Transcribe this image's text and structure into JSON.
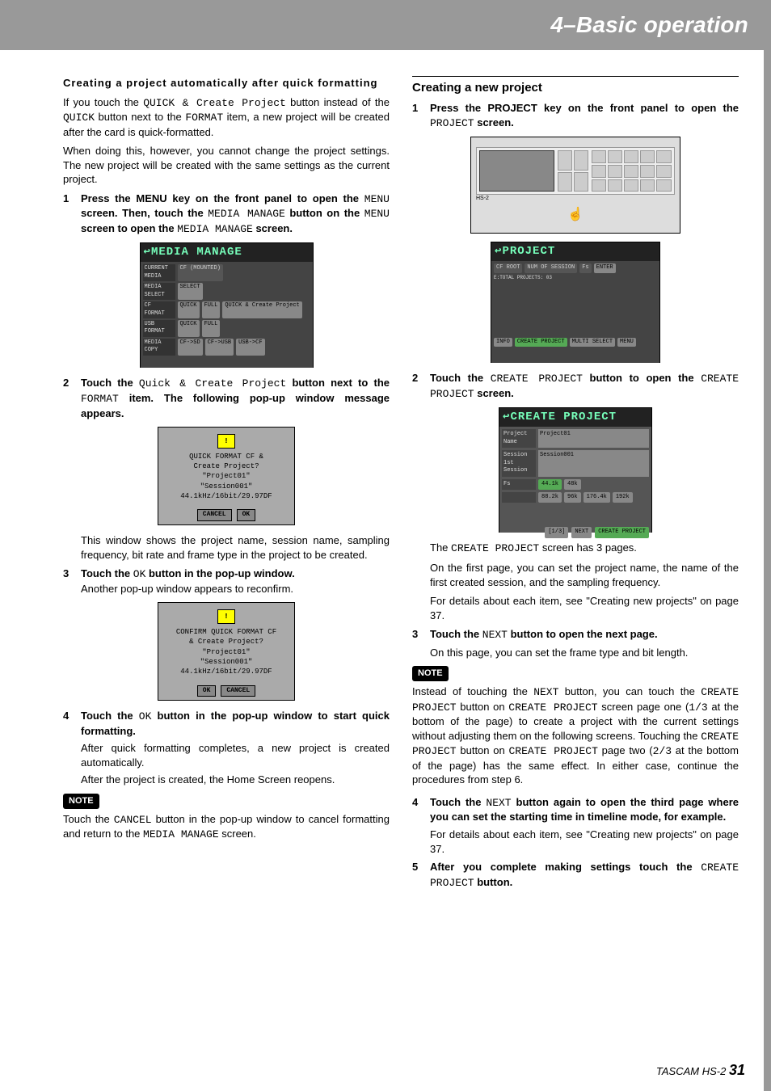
{
  "header": {
    "title": "4–Basic operation"
  },
  "left": {
    "sub_heading": "Creating a project automatically after quick formatting",
    "intro1_a": "If you touch the ",
    "intro1_mono_a": "QUICK & Create Project",
    "intro1_b": " button instead of the ",
    "intro1_mono_b": "QUICK",
    "intro1_c": " button next to the ",
    "intro1_mono_c": "FORMAT",
    "intro1_d": " item, a new project will be created after the card is quick-formatted.",
    "intro2": "When doing this, however, you cannot change the project settings. The new project will be created with the same settings as the current project.",
    "step1_a": "Press the MENU key on the front panel to open the ",
    "step1_mono_a": "MENU",
    "step1_b": " screen. Then, touch the ",
    "step1_mono_b": "MEDIA MANAGE",
    "step1_c": " button on the ",
    "step1_mono_c": "MENU",
    "step1_d": " screen to open the ",
    "step1_mono_d": "MEDIA MANAGE",
    "step1_e": " screen.",
    "step2_a": "Touch the ",
    "step2_mono_a": "Quick & Create Project",
    "step2_b": " button next to the ",
    "step2_mono_b": "FORMAT",
    "step2_c": " item. The following pop-up window message appears.",
    "after_popup1": "This window shows the project name, session name, sampling frequency, bit rate and frame type in the project to be created.",
    "step3_a": "Touch the ",
    "step3_mono_a": "OK",
    "step3_b": " button in the pop-up window.",
    "step3_after": "Another pop-up window appears to reconfirm.",
    "step4_a": "Touch the ",
    "step4_mono_a": "OK",
    "step4_b": " button in the pop-up window to start quick formatting.",
    "step4_after1": "After quick formatting completes, a new project is created automatically.",
    "step4_after2": "After the project is created, the Home Screen reopens.",
    "note_label": "NOTE",
    "note_a": "Touch the ",
    "note_mono_a": "CANCEL",
    "note_b": " button in the pop-up window to cancel formatting and return to the ",
    "note_mono_b": "MEDIA MANAGE",
    "note_c": " screen.",
    "media_shot": {
      "title": "MEDIA MANAGE",
      "rows": [
        {
          "label": "CURRENT MEDIA",
          "val": "CF (MOUNTED)"
        },
        {
          "label": "MEDIA SELECT",
          "btns": [
            "SELECT"
          ]
        },
        {
          "label": "CF FORMAT",
          "btns": [
            "QUICK",
            "FULL",
            "QUICK & Create Project"
          ]
        },
        {
          "label": "USB FORMAT",
          "btns": [
            "QUICK",
            "FULL"
          ]
        },
        {
          "label": "MEDIA COPY",
          "btns": [
            "CF->SD",
            "CF->USB",
            "USB->CF"
          ]
        }
      ]
    },
    "popup1": {
      "lines": [
        "QUICK FORMAT CF &",
        "Create Project?",
        "\"Project01\"",
        "\"Session001\"",
        "44.1kHz/16bit/29.97DF"
      ],
      "buttons": [
        "CANCEL",
        "OK"
      ]
    },
    "popup2": {
      "lines": [
        "CONFIRM QUICK FORMAT CF",
        "& Create Project?",
        "\"Project01\"",
        "\"Session001\"",
        "44.1kHz/16bit/29.97DF"
      ],
      "buttons": [
        "OK",
        "CANCEL"
      ]
    }
  },
  "right": {
    "section_heading": "Creating a new project",
    "step1_a": "Press the PROJECT key on the front panel to open the ",
    "step1_mono_a": "PROJECT",
    "step1_b": " screen.",
    "step2_a": "Touch the ",
    "step2_mono_a": "CREATE PROJECT",
    "step2_b": " button to open the ",
    "step2_mono_b": "CREATE PROJECT",
    "step2_c": " screen.",
    "after2_a": "The ",
    "after2_mono_a": "CREATE PROJECT",
    "after2_b": " screen has 3 pages.",
    "after2_c": "On the first page, you can set the project name, the name of the first created session, and the sampling frequency.",
    "after2_d": "For details about each item, see \"Creating new projects\" on page 37.",
    "step3_a": "Touch the ",
    "step3_mono_a": "NEXT",
    "step3_b": " button to open the next page.",
    "step3_after": "On this page, you can set the frame type and bit length.",
    "note_label": "NOTE",
    "note_a": "Instead of touching the ",
    "note_mono_a": "NEXT",
    "note_b": " button, you can touch the ",
    "note_mono_b": "CREATE PROJECT",
    "note_c": " button on ",
    "note_mono_c": "CREATE PROJECT",
    "note_d": " screen page one (",
    "note_mono_d": "1/3",
    "note_e": " at the bottom of the page) to create a project with the current settings without adjusting them on the following screens. Touching the ",
    "note_mono_e": "CREATE PROJECT",
    "note_f": " button on ",
    "note_mono_f": "CREATE PROJECT",
    "note_g": " page two (",
    "note_mono_g": "2/3",
    "note_h": " at the bottom of the page) has the same effect. In either case, continue the procedures from step 6.",
    "step4_a": "Touch the ",
    "step4_mono_a": "NEXT",
    "step4_b": " button again to open the third page where you can set the starting time in timeline mode, for example.",
    "step4_after": "For details about each item, see \"Creating new projects\" on page 37.",
    "step5_a": "After you complete making settings touch the ",
    "step5_mono_a": "CREATE PROJECT",
    "step5_b": " button.",
    "device_label": "HS-2",
    "project_shot": {
      "title": "PROJECT",
      "header": [
        "CF ROOT",
        "NUM OF SESSION",
        "Fs",
        "ENTER"
      ],
      "sub": "E:TOTAL PROJECTS: 03",
      "footer": [
        "INFO",
        "CREATE PROJECT",
        "MULTI SELECT",
        "MENU"
      ]
    },
    "create_shot": {
      "title": "CREATE PROJECT",
      "project_name": "Project01",
      "session_name_label": "Session 1st Session",
      "session_name": "Session001",
      "fs_options": [
        "44.1k",
        "48k",
        "88.2k",
        "96k",
        "176.4k",
        "192k"
      ],
      "footer": [
        "[1/3]",
        "NEXT",
        "CREATE PROJECT"
      ]
    }
  },
  "footer": {
    "brand": "TASCAM HS-2",
    "page": "31"
  }
}
